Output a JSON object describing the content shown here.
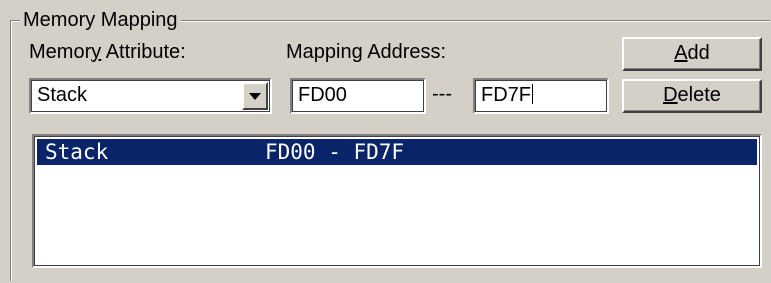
{
  "group": {
    "title": "Memory Mapping"
  },
  "attribute": {
    "label_pre": "Memor",
    "label_mnemonic": "y",
    "label_post": " Attribute:",
    "value": "Stack"
  },
  "address": {
    "label_pre": "Mappin",
    "label_mnemonic": "g",
    "label_post": " Address:",
    "start": "FD00",
    "separator": "---",
    "end": "FD7F"
  },
  "buttons": {
    "add_mnemonic": "A",
    "add_rest": "dd",
    "delete_mnemonic": "D",
    "delete_rest": "elete"
  },
  "list": {
    "rows": [
      {
        "name": "Stack",
        "range": "FD00 - FD7F",
        "selected": true
      }
    ]
  },
  "icons": {
    "combo_arrow": "chevron-down-icon"
  }
}
